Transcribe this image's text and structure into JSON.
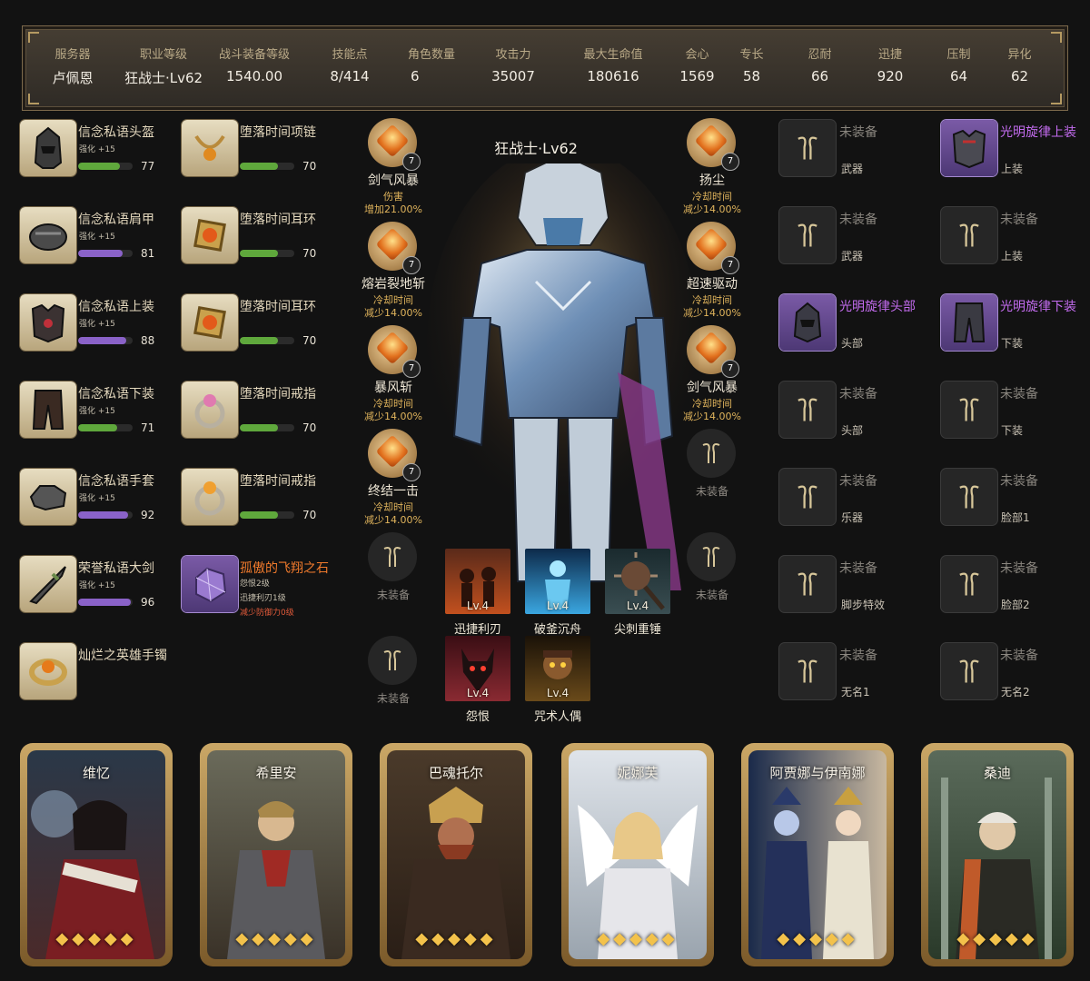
{
  "stats": [
    {
      "label": "服务器",
      "value": "卢佩恩"
    },
    {
      "label": "职业等级",
      "value": "狂战士·Lv62"
    },
    {
      "label": "战斗装备等级",
      "value": "1540.00"
    },
    {
      "label": "技能点",
      "value": "8/414"
    },
    {
      "label": "角色数量",
      "value": "6"
    },
    {
      "label": "攻击力",
      "value": "35007"
    },
    {
      "label": "最大生命值",
      "value": "180616"
    },
    {
      "label": "会心",
      "value": "1569"
    },
    {
      "label": "专长",
      "value": "58"
    },
    {
      "label": "忍耐",
      "value": "66"
    },
    {
      "label": "迅捷",
      "value": "920"
    },
    {
      "label": "压制",
      "value": "64"
    },
    {
      "label": "异化",
      "value": "62"
    }
  ],
  "armor": [
    {
      "name": "信念私语头盔",
      "enhance": "强化 +15",
      "value": "77",
      "fill": 0.77,
      "bar": "#5fa83c"
    },
    {
      "name": "信念私语肩甲",
      "enhance": "强化 +15",
      "value": "81",
      "fill": 0.81,
      "bar": "#8a62c8"
    },
    {
      "name": "信念私语上装",
      "enhance": "强化 +15",
      "value": "88",
      "fill": 0.88,
      "bar": "#8a62c8"
    },
    {
      "name": "信念私语下装",
      "enhance": "强化 +15",
      "value": "71",
      "fill": 0.71,
      "bar": "#5fa83c"
    },
    {
      "name": "信念私语手套",
      "enhance": "强化 +15",
      "value": "92",
      "fill": 0.92,
      "bar": "#8a62c8"
    },
    {
      "name": "荣誉私语大剑",
      "enhance": "强化 +15",
      "value": "96",
      "fill": 0.96,
      "bar": "#8a62c8"
    },
    {
      "name": "灿烂之英雄手镯"
    }
  ],
  "accessories": [
    {
      "name": "堕落时间项链",
      "value": "70",
      "fill": 0.7
    },
    {
      "name": "堕落时间耳环",
      "value": "70",
      "fill": 0.7
    },
    {
      "name": "堕落时间耳环",
      "value": "70",
      "fill": 0.7
    },
    {
      "name": "堕落时间戒指",
      "value": "70",
      "fill": 0.7
    },
    {
      "name": "堕落时间戒指",
      "value": "70",
      "fill": 0.7
    }
  ],
  "stone": {
    "name": "孤傲的飞翔之石",
    "line1": "怨恨2级",
    "line2": "迅捷利刃1级",
    "line3": "减少防御力0级"
  },
  "engravings_left": [
    {
      "name": "剑气风暴",
      "eff1": "伤害",
      "eff2": "增加21.00%",
      "level": "7"
    },
    {
      "name": "熔岩裂地斩",
      "eff1": "冷却时间",
      "eff2": "减少14.00%",
      "level": "7"
    },
    {
      "name": "暴风斩",
      "eff1": "冷却时间",
      "eff2": "减少14.00%",
      "level": "7"
    },
    {
      "name": "终结一击",
      "eff1": "冷却时间",
      "eff2": "减少14.00%",
      "level": "7"
    }
  ],
  "engravings_right": [
    {
      "name": "扬尘",
      "eff1": "冷却时间",
      "eff2": "减少14.00%",
      "level": "7"
    },
    {
      "name": "超速驱动",
      "eff1": "冷却时间",
      "eff2": "减少14.00%",
      "level": "7"
    },
    {
      "name": "剑气风暴",
      "eff1": "冷却时间",
      "eff2": "减少14.00%",
      "level": "7"
    }
  ],
  "unequipped": "未装备",
  "character_name": "狂战士·Lv62",
  "skill_cards": [
    {
      "name": "迅捷利刃",
      "lv": "Lv.4"
    },
    {
      "name": "破釜沉舟",
      "lv": "Lv.4"
    },
    {
      "name": "尖刺重锤",
      "lv": "Lv.4"
    },
    {
      "name": "怨恨",
      "lv": "Lv.4"
    },
    {
      "name": "咒术人偶",
      "lv": "Lv.4"
    }
  ],
  "avatar_col1": [
    {
      "name": "未装备",
      "sub": "武器"
    },
    {
      "name": "未装备",
      "sub": "武器"
    },
    {
      "name": "光明旋律头部",
      "sub": "头部"
    },
    {
      "name": "未装备",
      "sub": "头部"
    },
    {
      "name": "未装备",
      "sub": "乐器"
    },
    {
      "name": "未装备",
      "sub": "脚步特效"
    },
    {
      "name": "未装备",
      "sub": "无名1"
    }
  ],
  "avatar_col2": [
    {
      "name": "光明旋律上装",
      "sub": "上装"
    },
    {
      "name": "未装备",
      "sub": "上装"
    },
    {
      "name": "光明旋律下装",
      "sub": "下装"
    },
    {
      "name": "未装备",
      "sub": "下装"
    },
    {
      "name": "未装备",
      "sub": "脸部1"
    },
    {
      "name": "未装备",
      "sub": "脸部2"
    },
    {
      "name": "未装备",
      "sub": "无名2"
    }
  ],
  "cards": [
    {
      "name": "维忆",
      "stars": 5
    },
    {
      "name": "希里安",
      "stars": 5
    },
    {
      "name": "巴魂托尔",
      "stars": 5
    },
    {
      "name": "妮娜芙",
      "stars": 5
    },
    {
      "name": "阿贾娜与伊南娜",
      "stars": 5
    },
    {
      "name": "桑迪",
      "stars": 5
    }
  ],
  "colors": {
    "gold": "#b59a62",
    "purple": "#c46cf0",
    "orange": "#f07a2c",
    "effect": "#e0b45c"
  }
}
